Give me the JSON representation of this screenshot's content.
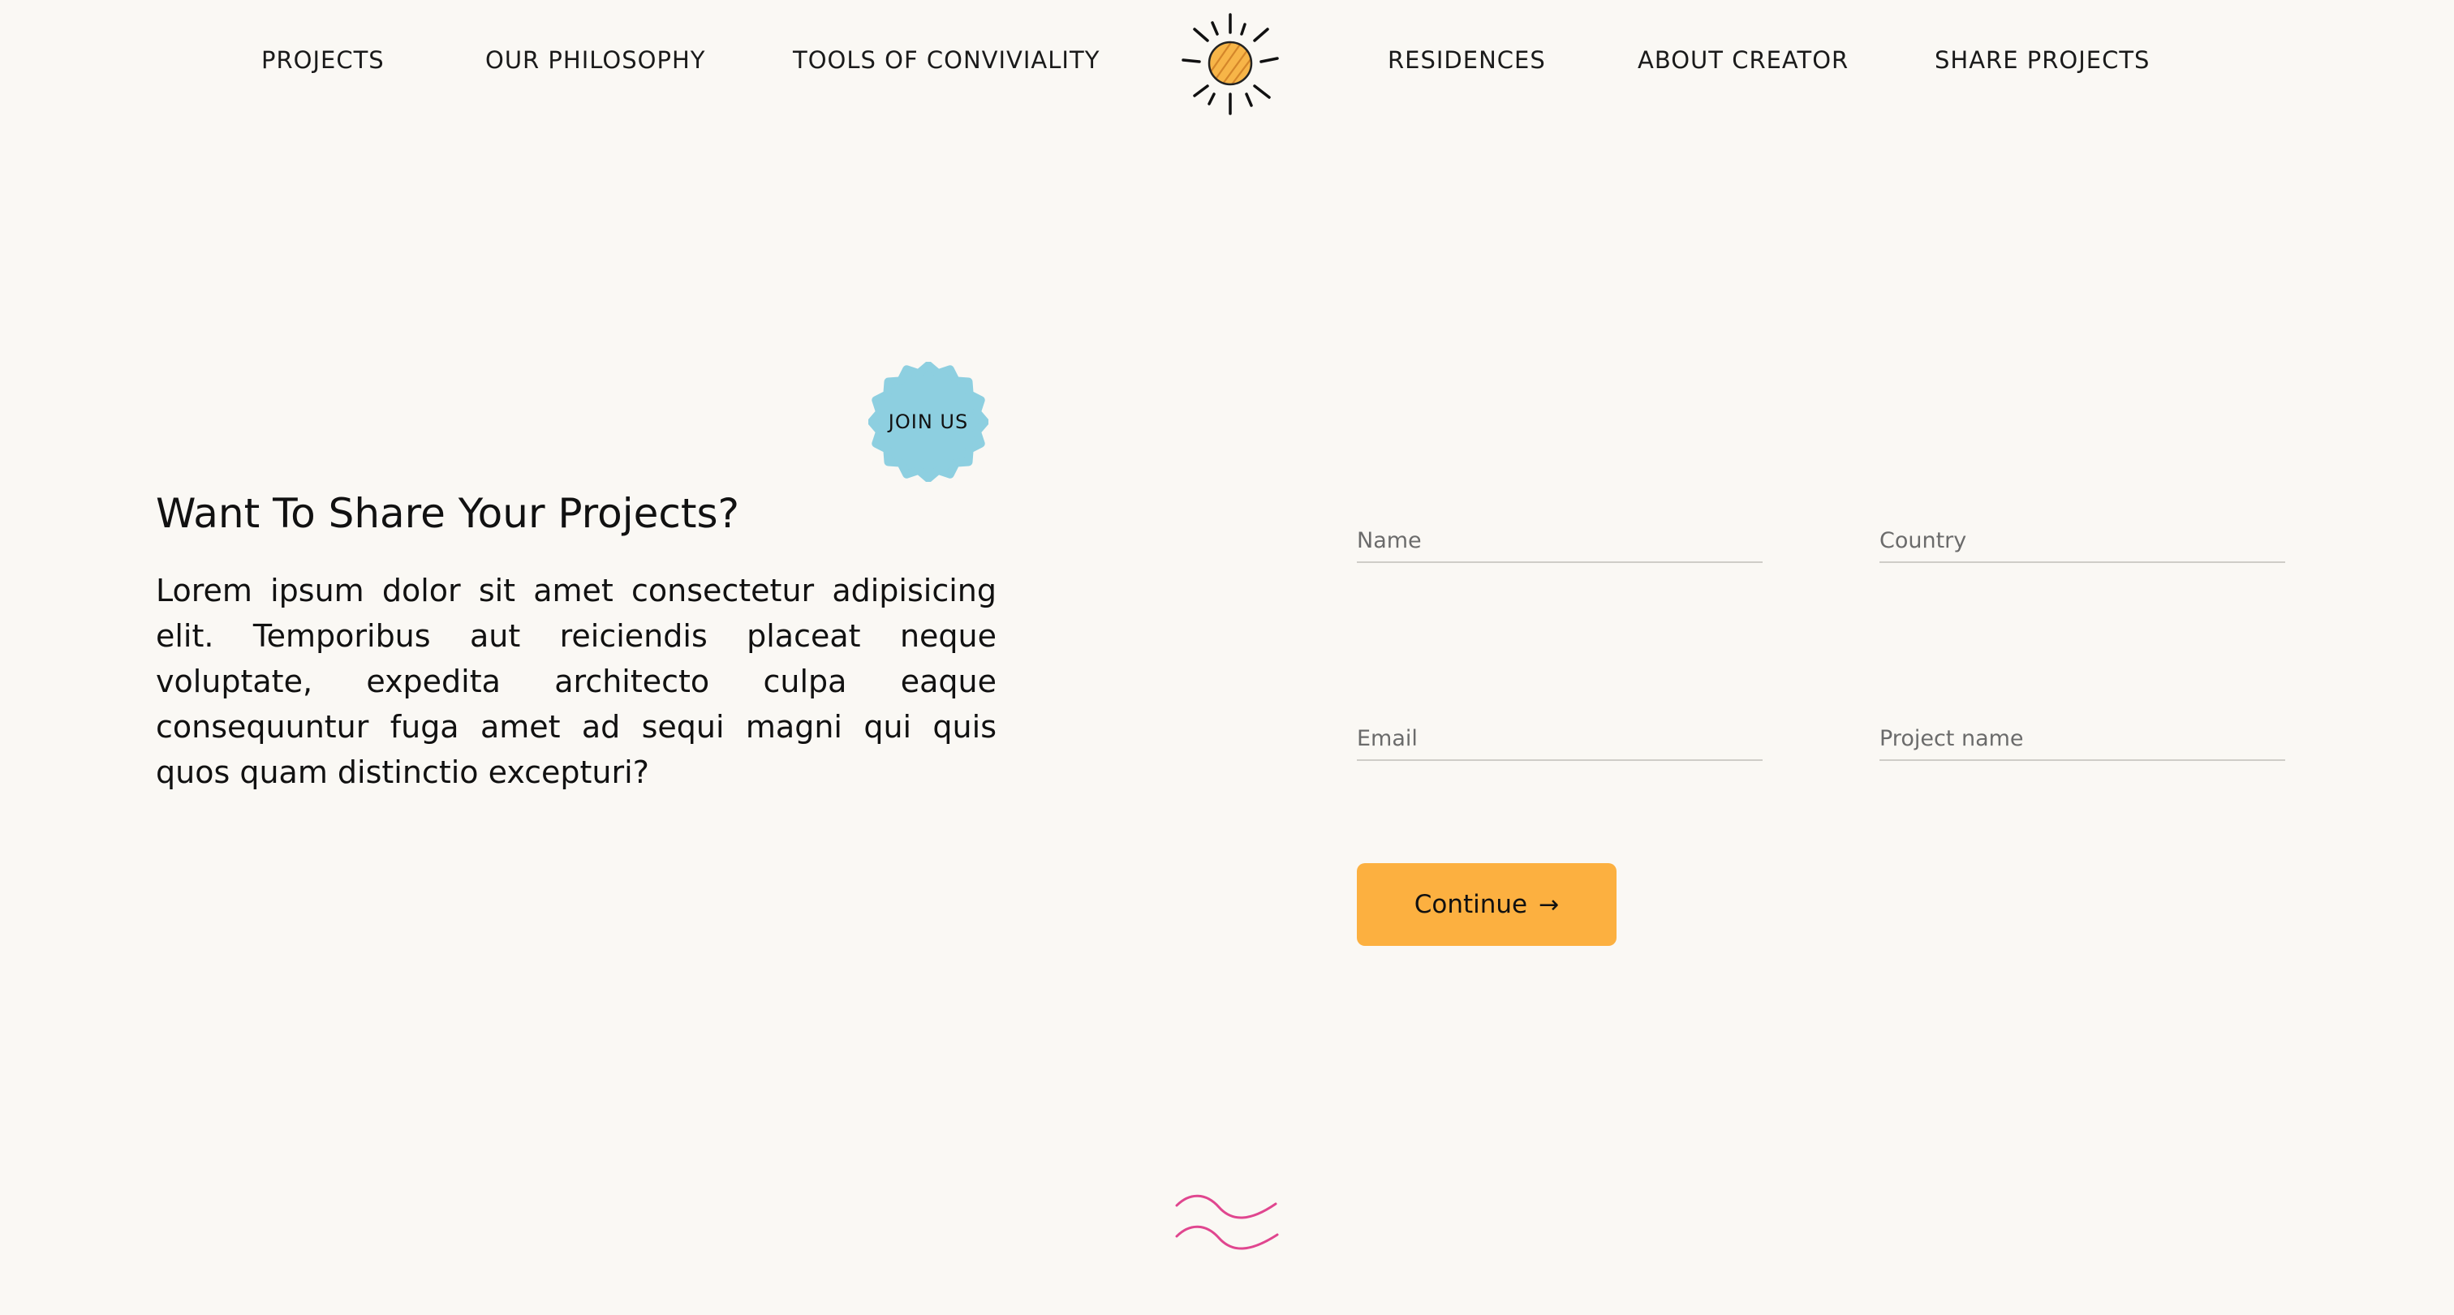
{
  "nav": {
    "left_items": [
      {
        "label": "PROJECTS"
      },
      {
        "label": "OUR PHILOSOPHY"
      },
      {
        "label": "TOOLS OF CONVIVIALITY"
      }
    ],
    "right_items": [
      {
        "label": "RESIDENCES"
      },
      {
        "label": "ABOUT CREATOR"
      },
      {
        "label": "SHARE PROJECTS"
      }
    ],
    "logo_icon": "sun-icon"
  },
  "badge": {
    "label": "JOIN US",
    "color": "#8dcfe0"
  },
  "intro": {
    "heading": "Want To Share Your Projects?",
    "body": "Lorem ipsum dolor sit amet consectetur adipisicing elit. Temporibus aut reiciendis placeat neque voluptate, expedita architecto culpa eaque consequuntur fuga amet ad sequi magni qui quis quos quam distinctio excepturi?"
  },
  "form": {
    "name_placeholder": "Name",
    "country_placeholder": "Country",
    "email_placeholder": "Email",
    "project_name_placeholder": "Project name",
    "submit_label": "Continue",
    "submit_icon": "arrow-right-icon",
    "submit_arrow": "→",
    "submit_color": "#fcb040"
  },
  "decor": {
    "waves_icon": "waves-icon",
    "waves_color": "#e0468f"
  }
}
